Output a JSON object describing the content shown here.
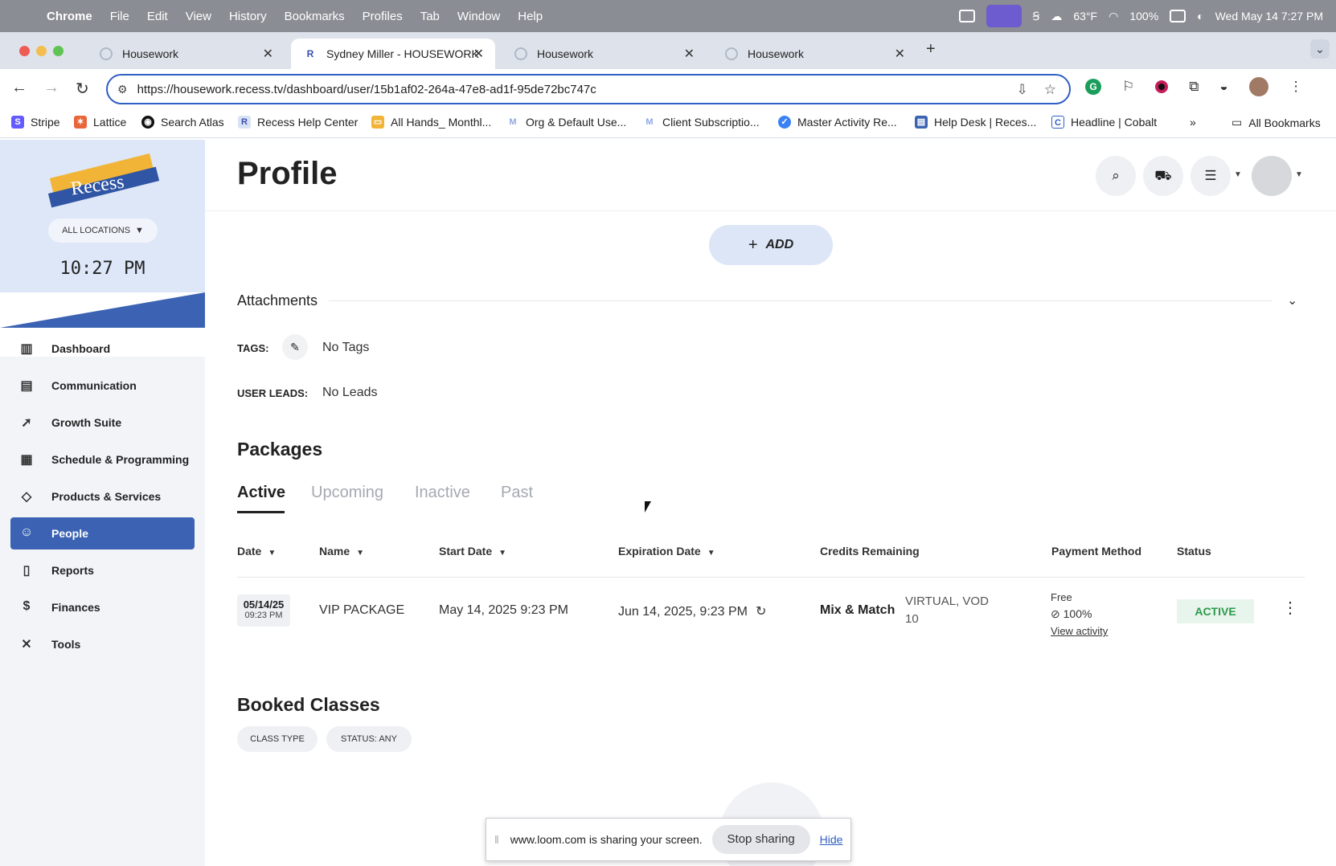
{
  "menubar": {
    "app": "Chrome",
    "items": [
      "File",
      "Edit",
      "View",
      "History",
      "Bookmarks",
      "Profiles",
      "Tab",
      "Window",
      "Help"
    ],
    "weather": "63°F",
    "battery": "100%",
    "datetime": "Wed May 14  7:27 PM"
  },
  "tabs": [
    {
      "title": "Housework"
    },
    {
      "title": "Sydney Miller - HOUSEWORK",
      "favicon": "R"
    },
    {
      "title": "Housework"
    },
    {
      "title": "Housework"
    }
  ],
  "address": {
    "url": "https://housework.recess.tv/dashboard/user/15b1af02-264a-47e8-ad1f-95de72bc747c"
  },
  "bookmarks": {
    "items": [
      {
        "label": "Stripe",
        "color": "#635bff",
        "glyph": "S"
      },
      {
        "label": "Lattice",
        "color": "#e8663a",
        "glyph": "✶"
      },
      {
        "label": "Search Atlas",
        "color": "#111111",
        "glyph": "◉"
      },
      {
        "label": "Recess Help Center",
        "color": "#d9e2f5",
        "glyph": "R"
      },
      {
        "label": "All Hands_ Monthl...",
        "color": "#f2b436",
        "glyph": "▭"
      },
      {
        "label": "Org & Default Use...",
        "color": "#8fa8e6",
        "glyph": "M"
      },
      {
        "label": "Client Subscriptio...",
        "color": "#8fa8e6",
        "glyph": "M"
      },
      {
        "label": "Master Activity Re...",
        "color": "#3b82f6",
        "glyph": "✓"
      },
      {
        "label": "Help Desk | Reces...",
        "color": "#3c63b3",
        "glyph": "▤"
      },
      {
        "label": "Headline | Cobalt",
        "color": "#2f5ec4",
        "glyph": "C"
      }
    ],
    "more": "»",
    "all": "All Bookmarks"
  },
  "sidebar": {
    "location_button": "ALL LOCATIONS",
    "clock": "10:27 PM",
    "logo_text": "Recess",
    "items": [
      {
        "label": "Dashboard",
        "icon": "chart-icon"
      },
      {
        "label": "Communication",
        "icon": "message-icon"
      },
      {
        "label": "Growth Suite",
        "icon": "rocket-icon"
      },
      {
        "label": "Schedule & Programming",
        "icon": "calendar-icon"
      },
      {
        "label": "Products & Services",
        "icon": "tag-icon"
      },
      {
        "label": "People",
        "icon": "people-icon",
        "active": true
      },
      {
        "label": "Reports",
        "icon": "report-icon"
      },
      {
        "label": "Finances",
        "icon": "finance-icon"
      },
      {
        "label": "Tools",
        "icon": "tools-icon"
      }
    ]
  },
  "page": {
    "title": "Profile",
    "add_button": "ADD",
    "attachments_label": "Attachments",
    "tags_label": "TAGS:",
    "tags_value": "No Tags",
    "leads_label": "USER LEADS:",
    "leads_value": "No Leads"
  },
  "packages": {
    "title": "Packages",
    "tabs": [
      "Active",
      "Upcoming",
      "Inactive",
      "Past"
    ],
    "active_tab": "Active",
    "columns": [
      "Date",
      "Name",
      "Start Date",
      "Expiration Date",
      "Credits Remaining",
      "Payment Method",
      "Status"
    ],
    "rows": [
      {
        "date": "05/14/25",
        "time": "09:23 PM",
        "name": "VIP PACKAGE",
        "start": "May 14, 2025 9:23 PM",
        "expiration": "Jun 14, 2025, 9:23 PM",
        "credits_type": "Mix & Match",
        "credits_kinds": "VIRTUAL, VOD",
        "credits_count": "10",
        "payment": "Free",
        "payment_pct": "100%",
        "payment_link": "View activity",
        "status": "ACTIVE"
      }
    ]
  },
  "booked": {
    "title": "Booked Classes",
    "filters": [
      "CLASS TYPE",
      "STATUS: ANY"
    ]
  },
  "loom": {
    "message": "www.loom.com is sharing your screen.",
    "stop": "Stop sharing",
    "hide": "Hide"
  },
  "colors": {
    "accent": "#3c63b3",
    "status_green": "#2a9a4a"
  }
}
